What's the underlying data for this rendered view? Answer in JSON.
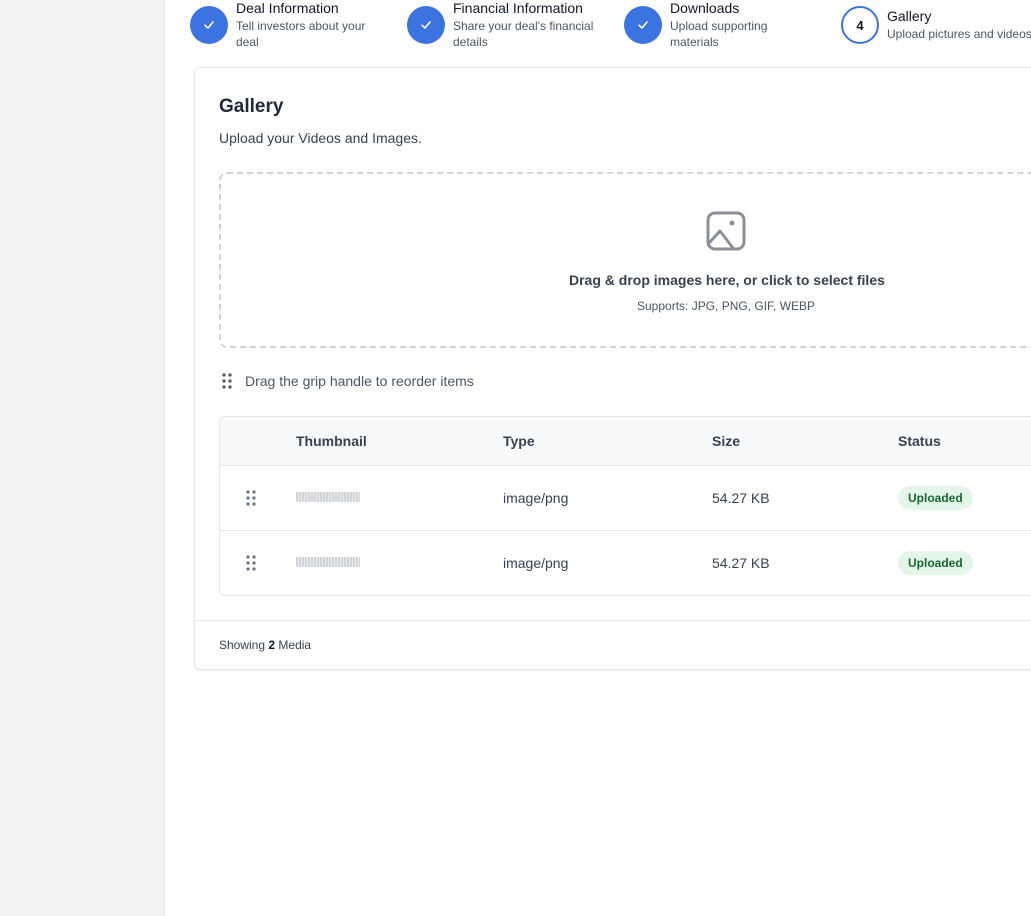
{
  "stepper": [
    {
      "title": "Deal Information",
      "desc_line1": "Tell investors about your",
      "desc_line2": "deal",
      "state": "done"
    },
    {
      "title": "Financial Information",
      "desc_line1": "Share your deal's financial",
      "desc_line2": "details",
      "state": "done"
    },
    {
      "title": "Downloads",
      "desc_line1": "Upload supporting",
      "desc_line2": "materials",
      "state": "done"
    },
    {
      "title": "Gallery",
      "desc_line1": "Upload pictures and videos",
      "desc_line2": "",
      "state": "current",
      "number": "4"
    }
  ],
  "gallery": {
    "title": "Gallery",
    "subtitle": "Upload your Videos and Images.",
    "dropzone": {
      "main": "Drag & drop images here, or click to select files",
      "sub": "Supports: JPG, PNG, GIF, WEBP",
      "icon": "image-icon"
    },
    "hint": "Drag the grip handle to reorder items",
    "table": {
      "headers": {
        "thumbnail": "Thumbnail",
        "type": "Type",
        "size": "Size",
        "status": "Status"
      },
      "rows": [
        {
          "type": "image/png",
          "size": "54.27 KB",
          "status": "Uploaded"
        },
        {
          "type": "image/png",
          "size": "54.27 KB",
          "status": "Uploaded"
        }
      ]
    },
    "footer": {
      "prefix": "Showing",
      "count": "2",
      "suffix": "Media"
    }
  },
  "colors": {
    "accent": "#3b73e0",
    "success_bg": "#e3f6e8",
    "success_text": "#166534"
  }
}
